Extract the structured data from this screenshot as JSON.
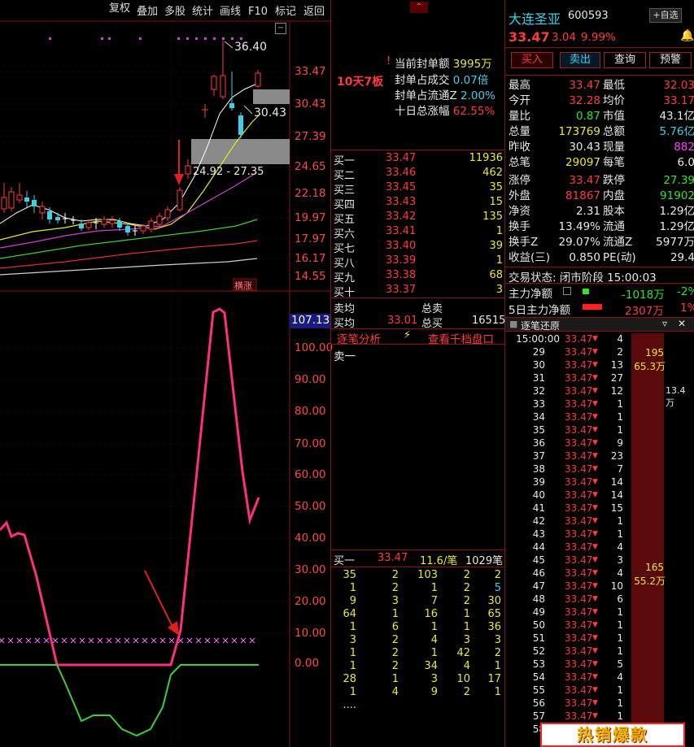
{
  "toolbar": {
    "items": [
      "复权",
      "叠加",
      "多股",
      "统计",
      "画线",
      "F10",
      "标记",
      "返回"
    ]
  },
  "stock": {
    "name": "大连圣亚",
    "code": "600593",
    "price": "33.47",
    "change": "3.04",
    "pct": "9.99%",
    "self_select": "+自选",
    "buy_btn": "买入",
    "sell_btn": "卖出",
    "query_btn": "查询",
    "alert_btn": "预警"
  },
  "kline": {
    "high_label": "36.40",
    "close_label": "30.43",
    "range_label": "24.92 - 27.35",
    "badge": "横涨",
    "price_scale": [
      "33.47",
      "30.43",
      "27.39",
      "24.65",
      "22.18",
      "19.97",
      "17.97",
      "16.17",
      "14.55"
    ]
  },
  "indicator": {
    "current": "107.13",
    "scale": [
      "100.00",
      "90.00",
      "80.00",
      "70.00",
      "60.00",
      "50.00",
      "40.00",
      "30.00",
      "20.00",
      "10.00",
      "0.00"
    ]
  },
  "limit_up": {
    "tag": "10天7板",
    "stats": [
      {
        "label": "当前封单额",
        "value": "3995万"
      },
      {
        "label": "封单占成交",
        "value": "0.07倍"
      },
      {
        "label": "封单占流通Z",
        "value": "2.00%"
      },
      {
        "label": "十日总涨幅",
        "value": "62.55%"
      }
    ]
  },
  "orderbook": {
    "bids": [
      {
        "label": "买一",
        "price": "33.47",
        "vol": "11936"
      },
      {
        "label": "买二",
        "price": "33.46",
        "vol": "462"
      },
      {
        "label": "买三",
        "price": "33.45",
        "vol": "35"
      },
      {
        "label": "买四",
        "price": "33.43",
        "vol": "15"
      },
      {
        "label": "买五",
        "price": "33.42",
        "vol": "135"
      },
      {
        "label": "买六",
        "price": "33.41",
        "vol": "1"
      },
      {
        "label": "买七",
        "price": "33.40",
        "vol": "39"
      },
      {
        "label": "买八",
        "price": "33.39",
        "vol": "1"
      },
      {
        "label": "买九",
        "price": "33.38",
        "vol": "68"
      },
      {
        "label": "买十",
        "price": "33.37",
        "vol": "3"
      }
    ],
    "sell_avg_label": "卖均",
    "sell_total_label": "总卖",
    "buy_avg_label": "买均",
    "buy_avg": "33.01",
    "buy_total_label": "总买",
    "buy_total": "16515",
    "tab_left": "逐笔分析",
    "tab_right": "查看千档盘口",
    "ask1_label": "卖一",
    "bid1_detail": {
      "label": "买一",
      "price": "33.47",
      "avg": "11.6/笔",
      "count": "1029笔"
    },
    "queue": [
      [
        "35",
        "2",
        "103",
        "2",
        "2"
      ],
      [
        "1",
        "2",
        "1",
        "2",
        "5"
      ],
      [
        "9",
        "3",
        "7",
        "2",
        "30"
      ],
      [
        "64",
        "1",
        "16",
        "1",
        "65"
      ],
      [
        "1",
        "6",
        "1",
        "1",
        "36"
      ],
      [
        "3",
        "2",
        "4",
        "3",
        "3"
      ],
      [
        "1",
        "2",
        "1",
        "42",
        "2"
      ],
      [
        "1",
        "2",
        "34",
        "4",
        "1"
      ],
      [
        "28",
        "1",
        "3",
        "10",
        "17"
      ],
      [
        "1",
        "4",
        "9",
        "2",
        "1"
      ],
      [
        "....",
        "",
        "",
        "",
        ""
      ]
    ]
  },
  "quote": {
    "rows": [
      {
        "l1": "最高",
        "v1": "33.47",
        "l2": "最低",
        "v2": "32.03"
      },
      {
        "l1": "今开",
        "v1": "32.28",
        "l2": "均价",
        "v2": "33.17"
      },
      {
        "l1": "量比",
        "v1": "0.87",
        "l2": "市值",
        "v2": "43.1亿"
      },
      {
        "l1": "总量",
        "v1": "173769",
        "l2": "总额",
        "v2": "5.76亿"
      },
      {
        "l1": "昨收",
        "v1": "30.43",
        "l2": "现量",
        "v2": "882"
      },
      {
        "l1": "总笔",
        "v1": "29097",
        "l2": "每笔",
        "v2": "6.0"
      },
      {
        "l1": "涨停",
        "v1": "33.47",
        "l2": "跌停",
        "v2": "27.39"
      },
      {
        "l1": "外盘",
        "v1": "81867",
        "l2": "内盘",
        "v2": "91902"
      },
      {
        "l1": "净资",
        "v1": "2.31",
        "l2": "股本",
        "v2": "1.29亿"
      },
      {
        "l1": "换手",
        "v1": "13.49%",
        "l2": "流通",
        "v2": "1.29亿"
      },
      {
        "l1": "换手Z",
        "v1": "29.07%",
        "l2": "流通Z",
        "v2": "5977万"
      },
      {
        "l1": "收益(三)",
        "v1": "0.850",
        "l2": "PE(动)",
        "v2": "29.4"
      }
    ],
    "status": "交易状态: 闭市阶段 15:00:03",
    "main_flow_label": "主力净额",
    "main_flow_value": "-1018万",
    "main_flow_pct": "-2%",
    "main5_label": "5日主力净额",
    "main5_value": "2307万",
    "main5_pct": "1%"
  },
  "ticks": {
    "title": "逐笔还原",
    "first_time": "15:00:00",
    "price": "33.47",
    "rows": [
      {
        "t": "15:00:00",
        "v": "4"
      },
      {
        "t": "29",
        "v": "2"
      },
      {
        "t": "30",
        "v": "13"
      },
      {
        "t": "31",
        "v": "27"
      },
      {
        "t": "32",
        "v": "12"
      },
      {
        "t": "33",
        "v": "1"
      },
      {
        "t": "34",
        "v": "1"
      },
      {
        "t": "35",
        "v": "1"
      },
      {
        "t": "36",
        "v": "9"
      },
      {
        "t": "37",
        "v": "23"
      },
      {
        "t": "38",
        "v": "7"
      },
      {
        "t": "39",
        "v": "14"
      },
      {
        "t": "40",
        "v": "14"
      },
      {
        "t": "41",
        "v": "15"
      },
      {
        "t": "42",
        "v": "1"
      },
      {
        "t": "43",
        "v": "1"
      },
      {
        "t": "44",
        "v": "4"
      },
      {
        "t": "45",
        "v": "3"
      },
      {
        "t": "46",
        "v": "4"
      },
      {
        "t": "47",
        "v": "10"
      },
      {
        "t": "48",
        "v": "6"
      },
      {
        "t": "49",
        "v": "1"
      },
      {
        "t": "50",
        "v": "1"
      },
      {
        "t": "51",
        "v": "1"
      },
      {
        "t": "52",
        "v": "1"
      },
      {
        "t": "53",
        "v": "5"
      },
      {
        "t": "54",
        "v": "4"
      },
      {
        "t": "55",
        "v": "1"
      },
      {
        "t": "56",
        "v": "1"
      },
      {
        "t": "57",
        "v": "1"
      },
      {
        "t": "58",
        "v": "1"
      }
    ],
    "big1": "195",
    "big1_amt": "65.3万",
    "side1": "13.4万",
    "big2": "165",
    "big2_amt": "55.2万",
    "banner": "热销爆款"
  },
  "colors": {
    "up": "#ff3b3b",
    "down": "#2ce52c",
    "accent": "#8b1010"
  }
}
